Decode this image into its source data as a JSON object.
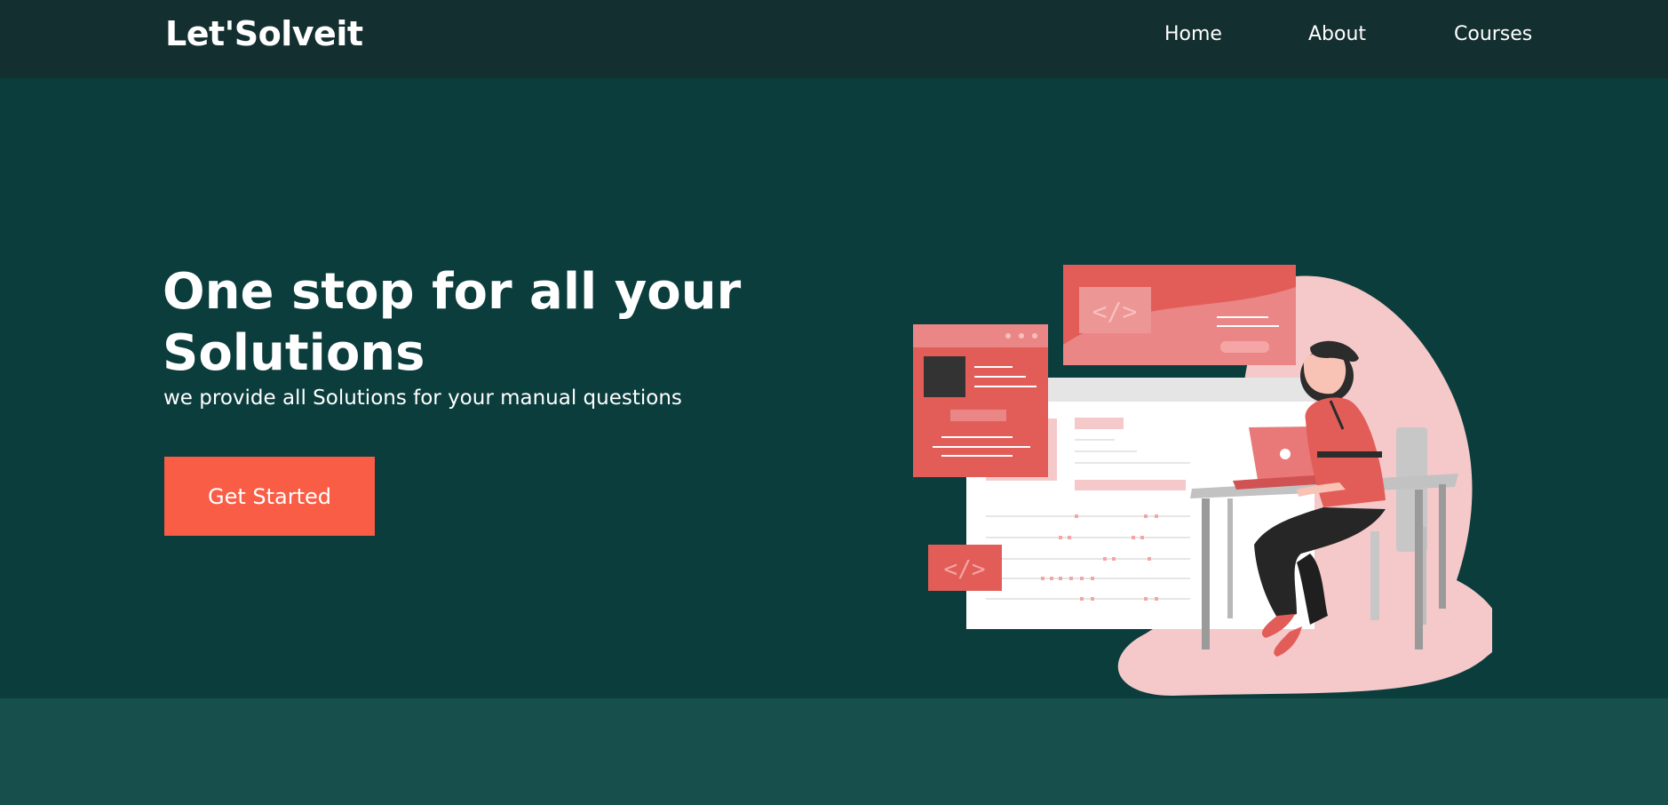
{
  "brand": {
    "name": "Let'Solveit"
  },
  "nav": {
    "items": [
      {
        "label": "Home"
      },
      {
        "label": "About"
      },
      {
        "label": "Courses"
      }
    ]
  },
  "hero": {
    "title": "One stop for all your Solutions",
    "subtitle": "we provide all Solutions for your manual questions",
    "cta_label": "Get Started"
  },
  "illustration": {
    "code_glyph": "</>"
  },
  "colors": {
    "navbar_bg": "#142f30",
    "hero_bg": "#0b3d3c",
    "lower_band_bg": "#174f4c",
    "accent": "#fa5d45",
    "illustration_red": "#e25d58",
    "illustration_pink": "#f5c9ca"
  }
}
